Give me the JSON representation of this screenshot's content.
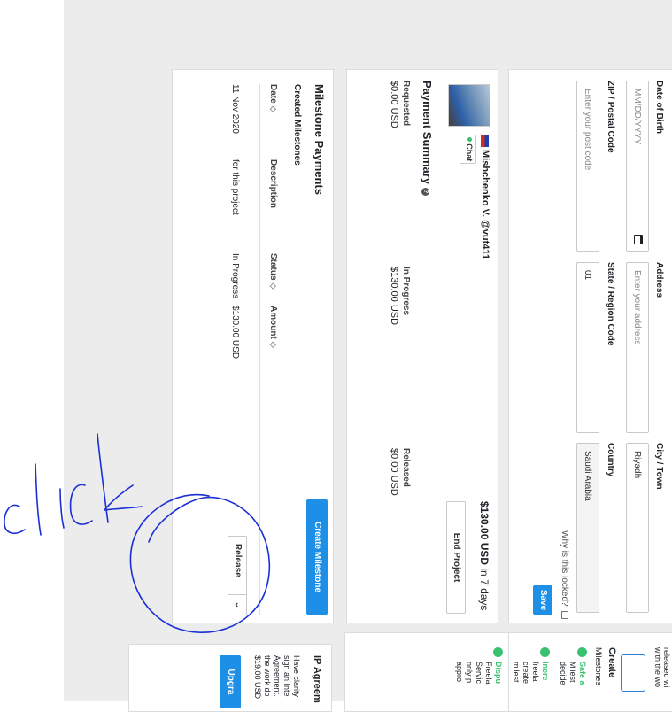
{
  "form": {
    "dob_label": "Date of Birth",
    "dob_placeholder": "MM/DD/YYYY",
    "address_label": "Address",
    "address_placeholder": "Enter your address",
    "city_label": "City / Town",
    "city_value": "Riyadh",
    "zip_label": "ZIP / Postal Code",
    "zip_placeholder": "Enter your post code",
    "state_label": "State / Region Code",
    "state_value": "01",
    "country_label": "Country",
    "country_value": "Saudi Arabia",
    "locked_link": "Why is this locked?",
    "save_label": "Save"
  },
  "user": {
    "name": "Mishchenko V. @vut411",
    "chat_label": "Chat",
    "project_amount": "$130.00 USD",
    "project_due": "in 7 days",
    "end_project_label": "End Project"
  },
  "payment_summary": {
    "title": "Payment Summary",
    "requested_label": "Requested",
    "requested_value": "$0.00 USD",
    "in_progress_label": "In Progress",
    "in_progress_value": "$130.00 USD",
    "released_label": "Released",
    "released_value": "$0.00 USD"
  },
  "milestones": {
    "title": "Milestone Payments",
    "subtitle": "Created Milestones",
    "create_label": "Create Milestone",
    "columns": [
      "Date",
      "Description",
      "Status",
      "Amount"
    ],
    "rows": [
      {
        "date": "11 Nov 2020",
        "description": "for this project",
        "status": "In Progress",
        "amount": "$130.00 USD",
        "action": "Release"
      }
    ]
  },
  "sidebar": {
    "top_text": "released wi",
    "top_text2": "with the wo",
    "create_title": "Create",
    "milestones_line": "Milestones",
    "safe_title": "Safe a",
    "safe_l1": "Milest",
    "safe_l2": "decide",
    "incr_title": "Incre",
    "incr_l1": "freela",
    "incr_l2": "create",
    "incr_l3": "milest",
    "disp_title": "Dispu",
    "disp_l1": "Freela",
    "disp_l2": "Servic",
    "disp_l3": "only p",
    "disp_l4": "appro",
    "ip_title": "IP Agreem",
    "ip_l1": "Have clarity",
    "ip_l2": "sign an Inte",
    "ip_l3": "Agreement.",
    "ip_l4": "the work do",
    "ip_l5": "$19.00 USD",
    "upgrade_label": "Upgra"
  },
  "annotation": {
    "text": "click",
    "color": "#1a2fd6"
  }
}
